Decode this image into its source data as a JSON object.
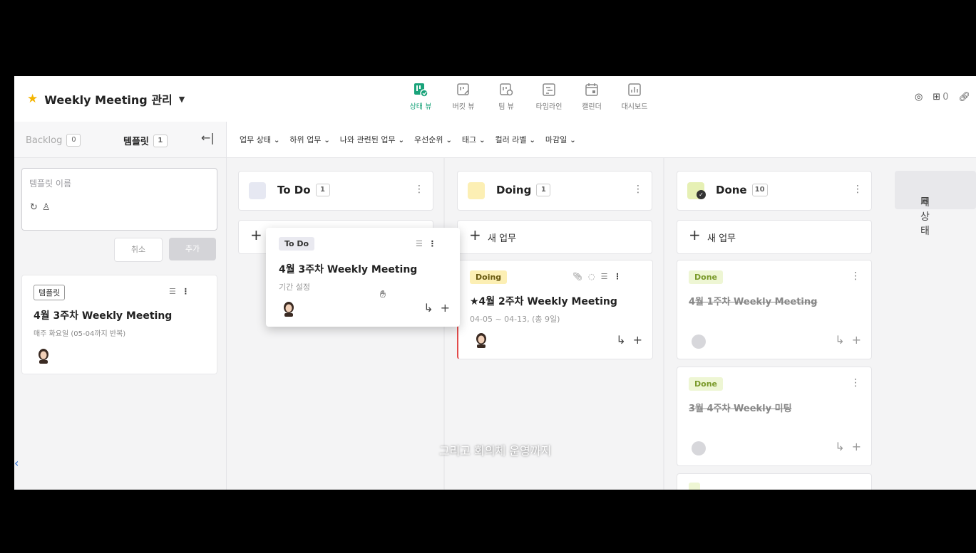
{
  "header": {
    "title": "Weekly Meeting 관리",
    "views": [
      {
        "label": "상태 뷰",
        "icon": "status-view-icon",
        "active": true
      },
      {
        "label": "버킷 뷰",
        "icon": "bucket-view-icon",
        "active": false
      },
      {
        "label": "팀 뷰",
        "icon": "team-view-icon",
        "active": false
      },
      {
        "label": "타임라인",
        "icon": "timeline-icon",
        "active": false
      },
      {
        "label": "캘린더",
        "icon": "calendar-icon",
        "active": false
      },
      {
        "label": "대시보드",
        "icon": "dashboard-icon",
        "active": false
      }
    ],
    "member_count": "0"
  },
  "sidebar": {
    "backlog_label": "Backlog",
    "backlog_count": "0",
    "template_label": "템플릿",
    "template_count": "1",
    "template_input_placeholder": "템플릿 이름",
    "cancel_label": "취소",
    "add_label": "추가",
    "template_card": {
      "tag": "템플릿",
      "title": "4월 3주차 Weekly Meeting",
      "subtitle": "매주 화요일 (05-04까지 반복)"
    }
  },
  "filters": [
    "업무 상태",
    "하위 업무",
    "나와 관련된 업무",
    "우선순위",
    "태그",
    "컬러 라벨",
    "마감일"
  ],
  "columns": {
    "todo": {
      "title": "To Do",
      "count": "1",
      "color": "#e6e8f2"
    },
    "doing": {
      "title": "Doing",
      "count": "1",
      "color": "#fcefb4"
    },
    "done": {
      "title": "Done",
      "count": "10",
      "color": "#e6f0b4"
    }
  },
  "new_task_label": "새 업무",
  "new_status_label": "새 상태",
  "drag_card": {
    "tag": "To Do",
    "title": "4월 3주차 Weekly Meeting",
    "subtitle": "기간 설정"
  },
  "doing_card": {
    "tag": "Doing",
    "title": "★4월 2주차 Weekly Meeting",
    "subtitle": "04-05 ~ 04-13, (총 9일)"
  },
  "done_cards": [
    {
      "tag": "Done",
      "title": "4월 1주차 Weekly Meeting"
    },
    {
      "tag": "Done",
      "title": "3월 4주차 Weekly 미팅"
    }
  ],
  "caption": "그리고 회의체 운영까지"
}
